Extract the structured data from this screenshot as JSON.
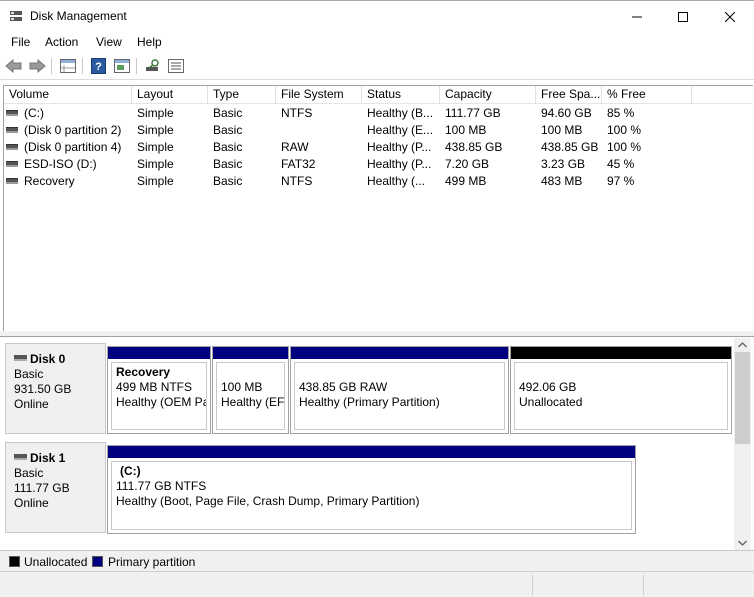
{
  "window": {
    "title": "Disk Management",
    "icon": "disk-management-icon"
  },
  "menu": [
    "File",
    "Action",
    "View",
    "Help"
  ],
  "toolbar_icons": [
    "back-arrow-icon",
    "forward-arrow-icon",
    "properties-icon",
    "help-icon",
    "console-icon",
    "rescan-disks-icon",
    "disk-list-icon"
  ],
  "columns": [
    "Volume",
    "Layout",
    "Type",
    "File System",
    "Status",
    "Capacity",
    "Free Spa...",
    "% Free"
  ],
  "volumes": [
    {
      "volume": "(C:)",
      "layout": "Simple",
      "type": "Basic",
      "fs": "NTFS",
      "status": "Healthy (B...",
      "capacity": "111.77 GB",
      "free": "94.60 GB",
      "pct": "85 %"
    },
    {
      "volume": "(Disk 0 partition 2)",
      "layout": "Simple",
      "type": "Basic",
      "fs": "",
      "status": "Healthy (E...",
      "capacity": "100 MB",
      "free": "100 MB",
      "pct": "100 %"
    },
    {
      "volume": "(Disk 0 partition 4)",
      "layout": "Simple",
      "type": "Basic",
      "fs": "RAW",
      "status": "Healthy (P...",
      "capacity": "438.85 GB",
      "free": "438.85 GB",
      "pct": "100 %"
    },
    {
      "volume": "ESD-ISO (D:)",
      "layout": "Simple",
      "type": "Basic",
      "fs": "FAT32",
      "status": "Healthy (P...",
      "capacity": "7.20 GB",
      "free": "3.23 GB",
      "pct": "45 %"
    },
    {
      "volume": "Recovery",
      "layout": "Simple",
      "type": "Basic",
      "fs": "NTFS",
      "status": "Healthy (...",
      "capacity": "499 MB",
      "free": "483 MB",
      "pct": "97 %"
    }
  ],
  "disks": [
    {
      "name": "Disk 0",
      "kind": "Basic",
      "size": "931.50 GB",
      "state": "Online",
      "partitions": [
        {
          "name": "Recovery",
          "line1": "499 MB NTFS",
          "line2": "Healthy (OEM Pa",
          "kind": "primary"
        },
        {
          "name": "",
          "line1": "100 MB",
          "line2": "Healthy (EFI",
          "kind": "primary"
        },
        {
          "name": "",
          "line1": "438.85 GB RAW",
          "line2": "Healthy (Primary Partition)",
          "kind": "primary"
        },
        {
          "name": "",
          "line1": "492.06 GB",
          "line2": "Unallocated",
          "kind": "unallocated"
        }
      ]
    },
    {
      "name": "Disk 1",
      "kind": "Basic",
      "size": "111.77 GB",
      "state": "Online",
      "partitions": [
        {
          "name": "(C:)",
          "line1": "111.77 GB NTFS",
          "line2": "Healthy (Boot, Page File, Crash Dump, Primary Partition)",
          "kind": "primary"
        }
      ]
    }
  ],
  "legend": [
    {
      "label": "Unallocated",
      "color": "#000000"
    },
    {
      "label": "Primary partition",
      "color": "#000080"
    }
  ],
  "colors": {
    "primary": "#000080",
    "unallocated": "#000000"
  }
}
